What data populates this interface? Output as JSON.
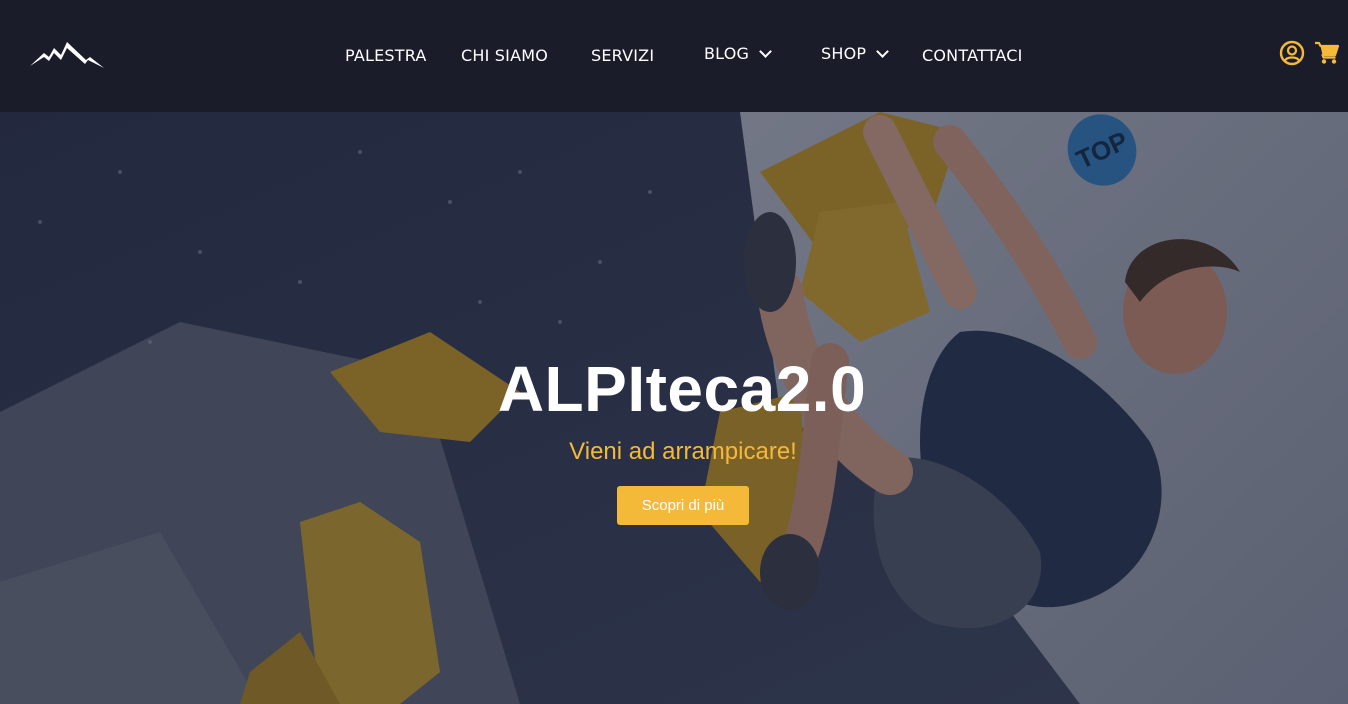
{
  "header": {
    "logo_icon": "mountain-logo",
    "nav": {
      "palestra": "PALESTRA",
      "chi_siamo": "CHI SIAMO",
      "servizi": "SERVIZI",
      "blog": "BLOG",
      "shop": "SHOP",
      "contattaci": "CONTATTACI"
    },
    "account_icon": "user-circle-icon",
    "cart_icon": "shopping-cart-icon"
  },
  "hero": {
    "title": "ALPIteca2.0",
    "subtitle": "Vieni ad arrampicare!",
    "cta_label": "Scopri di più",
    "wall_badge": "TOP"
  },
  "colors": {
    "header_bg": "#1b1c2a",
    "accent": "#f5b93a",
    "text": "#ffffff",
    "wall_badge": "#2f7fc2"
  }
}
